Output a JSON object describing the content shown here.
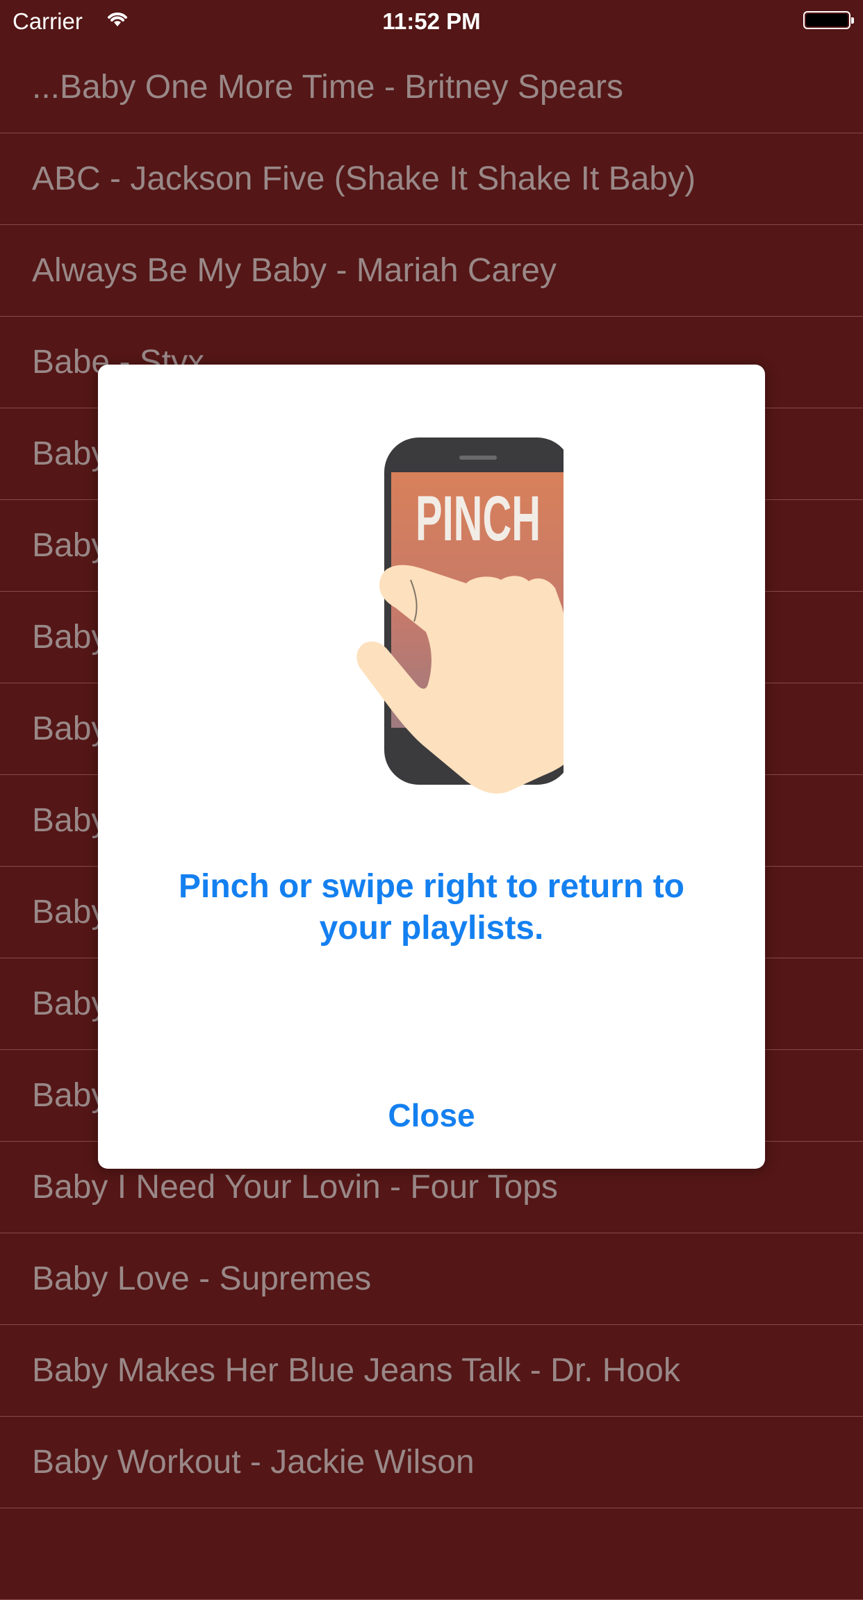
{
  "status_bar": {
    "carrier": "Carrier",
    "time": "11:52 PM"
  },
  "songs": [
    "...Baby One More Time - Britney Spears",
    "ABC - Jackson Five (Shake It Shake It Baby)",
    "Always Be My Baby - Mariah Carey",
    "Babe - Styx",
    "Baby",
    "Baby",
    "Baby",
    "Baby",
    "Baby",
    "Baby",
    "Baby",
    "Baby",
    "Baby I Need Your Lovin - Four Tops",
    "Baby Love - Supremes",
    "Baby Makes Her Blue Jeans Talk - Dr. Hook",
    "Baby Workout - Jackie Wilson",
    ""
  ],
  "dialog": {
    "illustration_word": "PINCH",
    "message": "Pinch or swipe right to return to your playlists.",
    "close_label": "Close"
  },
  "colors": {
    "background": "#541616",
    "accent": "#1480f0",
    "list_text": "#9a8888"
  }
}
